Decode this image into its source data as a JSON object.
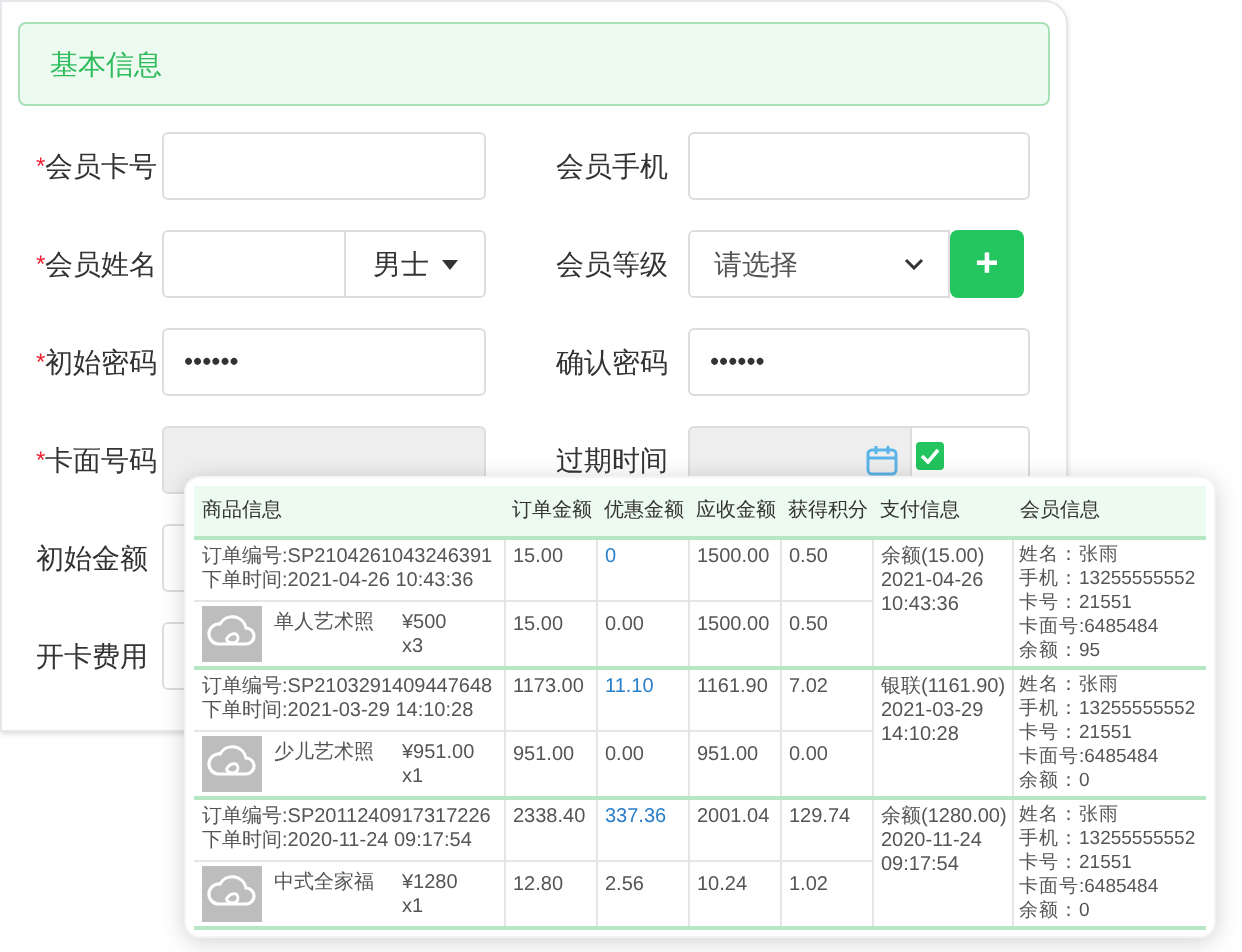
{
  "form": {
    "header": "基本信息",
    "rows": [
      [
        {
          "label": "会员卡号",
          "required_mark": "*",
          "kind": "text"
        },
        {
          "label": "会员手机",
          "kind": "text"
        }
      ],
      [
        {
          "label": "会员姓名",
          "required_mark": "*",
          "kind": "name-sex",
          "sex": "男士"
        },
        {
          "label": "会员等级",
          "kind": "select",
          "value": "请选择",
          "add_button": "+"
        }
      ],
      [
        {
          "label": "初始密码",
          "required_mark": "*",
          "kind": "password",
          "value": "••••••"
        },
        {
          "label": "确认密码",
          "kind": "password",
          "value": "••••••"
        }
      ],
      [
        {
          "label": "卡面号码",
          "required_mark": "*",
          "kind": "text",
          "disabled": true
        },
        {
          "label": "过期时间",
          "kind": "date",
          "disabled": true,
          "permanent": {
            "checked": true
          }
        }
      ],
      [
        {
          "label": "初始金额",
          "kind": "text"
        }
      ],
      [
        {
          "label": "开卡费用",
          "kind": "text"
        }
      ]
    ]
  },
  "orders_table": {
    "columns": [
      "商品信息",
      "订单金额",
      "优惠金额",
      "应收金额",
      "获得积分",
      "支付信息",
      "会员信息"
    ],
    "orders": [
      {
        "order_no": "订单编号:SP2104261043246391",
        "order_time": "下单时间:2021-04-26 10:43:36",
        "order_amount": "15.00",
        "discount": "0",
        "receivable": "1500.00",
        "points": "0.50",
        "payment": [
          "余额(15.00)",
          "2021-04-26",
          "10:43:36"
        ],
        "member": [
          "姓名：张雨",
          "手机：13255555552",
          "卡号：21551",
          "卡面号:6485484",
          "余额：95"
        ],
        "item": {
          "name": "单人艺术照",
          "price": "¥500",
          "qty": "x3",
          "order_amount": "15.00",
          "discount": "0.00",
          "receivable": "1500.00",
          "points": "0.50"
        }
      },
      {
        "order_no": "订单编号:SP2103291409447648",
        "order_time": "下单时间:2021-03-29 14:10:28",
        "order_amount": "1173.00",
        "discount": "11.10",
        "receivable": "1161.90",
        "points": "7.02",
        "payment": [
          "银联(1161.90)",
          "2021-03-29",
          "14:10:28"
        ],
        "member": [
          "姓名：张雨",
          "手机：13255555552",
          "卡号：21551",
          "卡面号:6485484",
          "余额：0"
        ],
        "item": {
          "name": "少儿艺术照",
          "price": "¥951.00",
          "qty": "x1",
          "order_amount": "951.00",
          "discount": "0.00",
          "receivable": "951.00",
          "points": "0.00"
        }
      },
      {
        "order_no": "订单编号:SP2011240917317226",
        "order_time": "下单时间:2020-11-24 09:17:54",
        "order_amount": "2338.40",
        "discount": "337.36",
        "receivable": "2001.04",
        "points": "129.74",
        "payment": [
          "余额(1280.00)",
          "2020-11-24",
          "09:17:54"
        ],
        "member": [
          "姓名：张雨",
          "手机：13255555552",
          "卡号：21551",
          "卡面号:6485484",
          "余额：0"
        ],
        "item": {
          "name": "中式全家福",
          "price": "¥1280",
          "qty": "x1",
          "order_amount": "12.80",
          "discount": "2.56",
          "receivable": "10.24",
          "points": "1.02"
        }
      }
    ]
  }
}
